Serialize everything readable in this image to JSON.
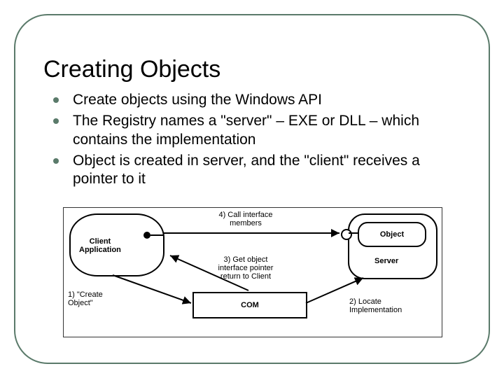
{
  "title": "Creating Objects",
  "bullets": [
    "Create objects using the Windows API",
    "The Registry names a \"server\" – EXE or DLL – which contains the implementation",
    "Object is created in server, and the \"client\" receives a pointer to it"
  ],
  "diagram": {
    "client_label": "Client\nApplication",
    "object_label": "Object",
    "server_label": "Server",
    "com_label": "COM",
    "captions": {
      "call_interface": "4) Call interface\nmembers",
      "get_pointer": "3) Get object\ninterface pointer\nreturn to Client",
      "create_object": "1) \"Create\nObject\"",
      "locate_impl": "2) Locate\nImplementation"
    }
  }
}
